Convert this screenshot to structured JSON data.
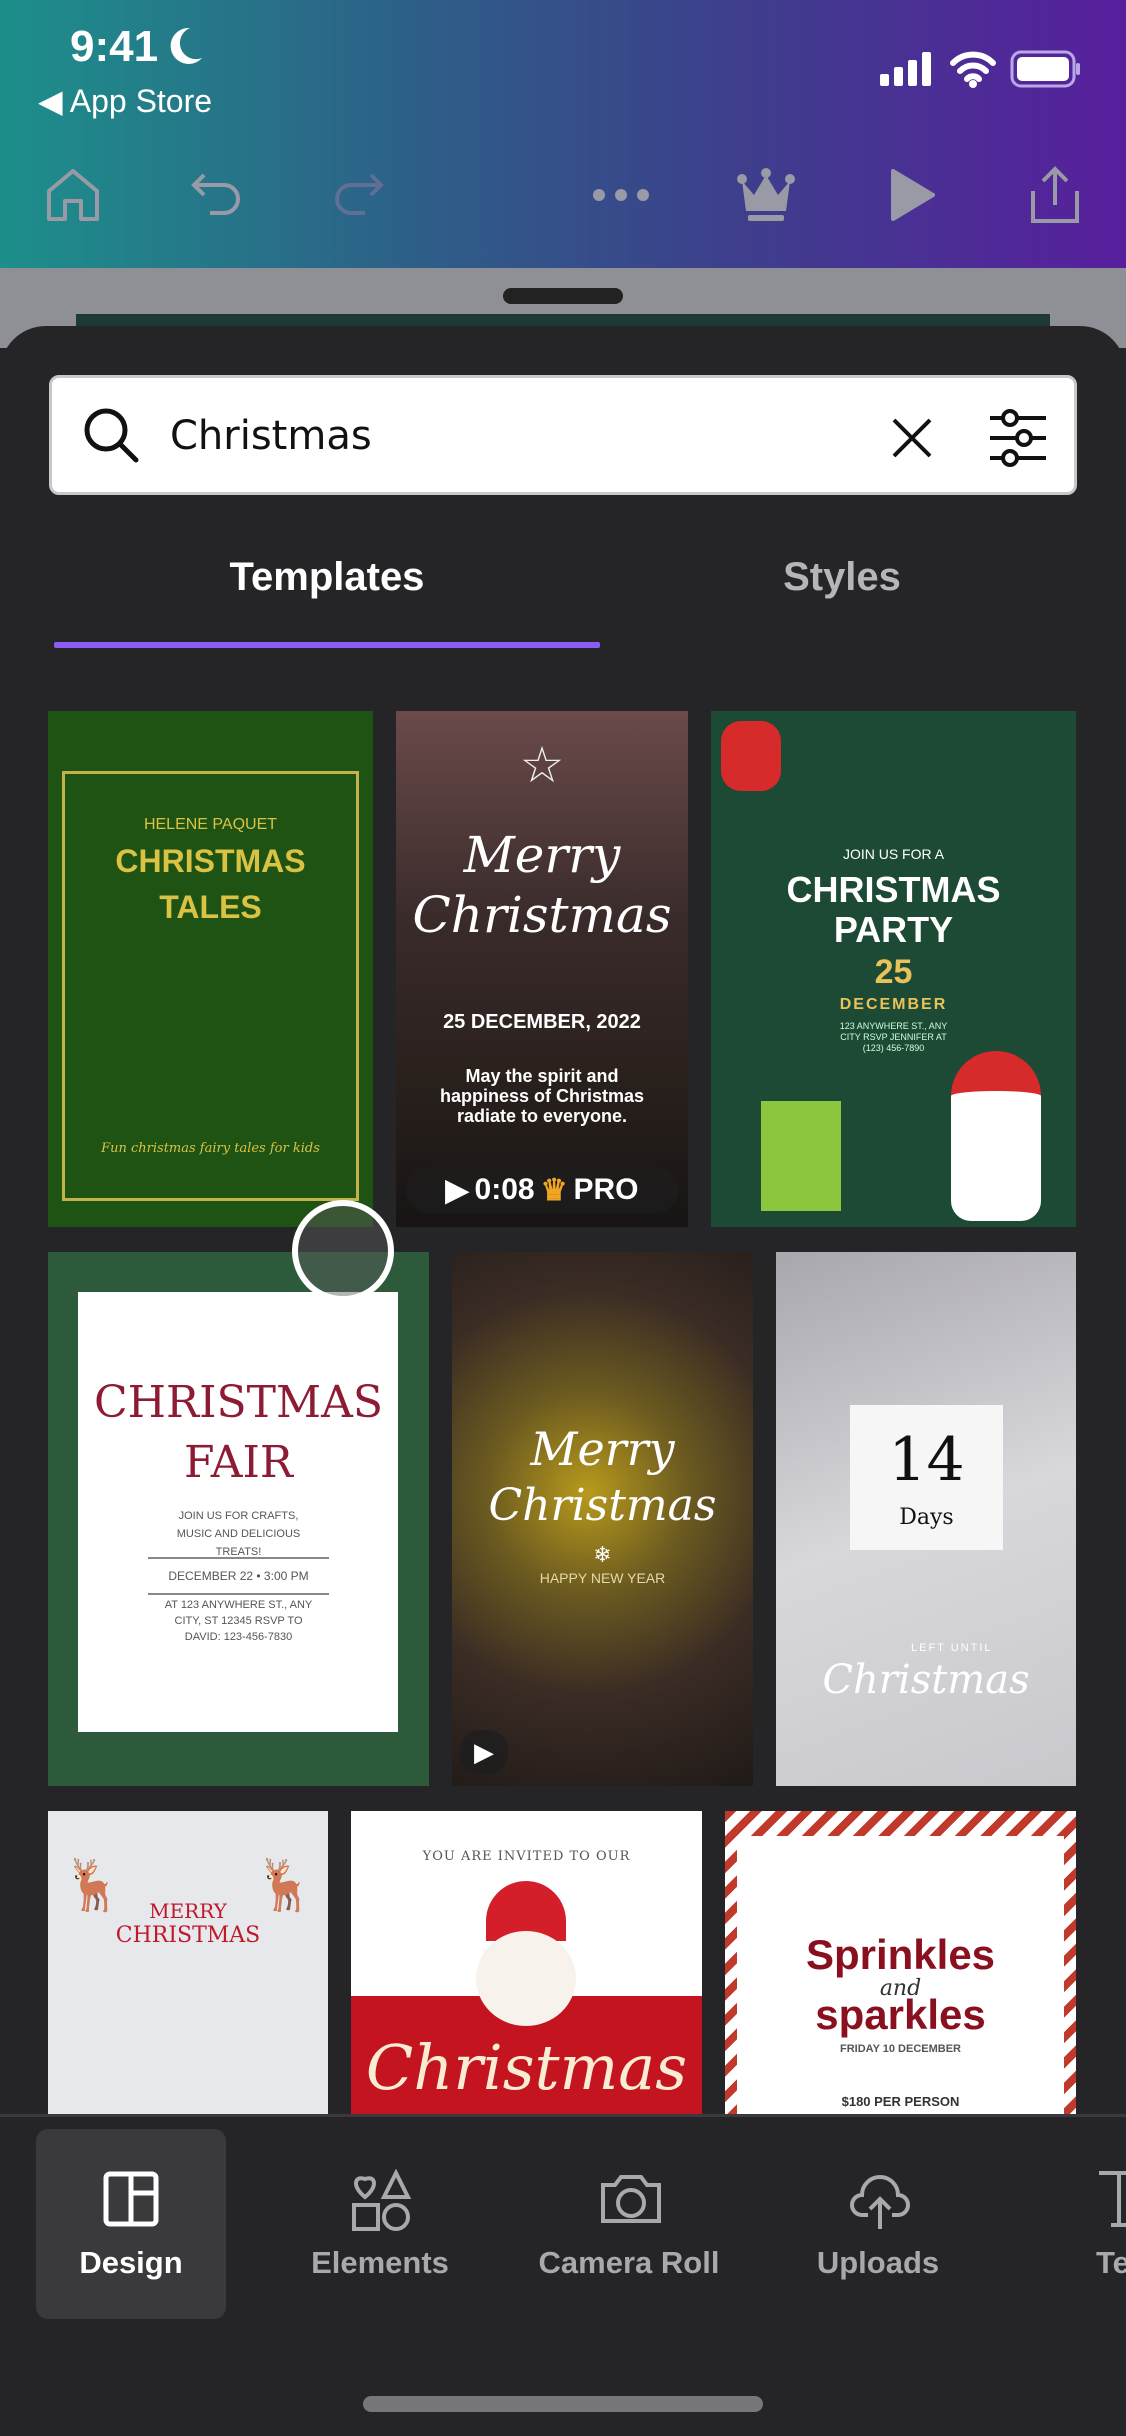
{
  "status_bar": {
    "time": "9:41",
    "back_label": "App Store",
    "icons": [
      "moon-icon",
      "signal-icon",
      "wifi-icon",
      "battery-icon"
    ]
  },
  "toolbar": {
    "icons": [
      "home-icon",
      "undo-icon",
      "redo-icon",
      "more-icon",
      "crown-icon",
      "play-icon",
      "share-icon"
    ]
  },
  "search": {
    "value": "Christmas"
  },
  "tabs": [
    {
      "label": "Templates",
      "active": true
    },
    {
      "label": "Styles",
      "active": false
    }
  ],
  "accent": "#8b5cf6",
  "templates": [
    {
      "author": "HELENE PAQUET",
      "title1": "CHRISTMAS",
      "title2": "TALES",
      "footer": "Fun christmas fairy tales for kids"
    },
    {
      "script1": "Merry",
      "script2": "Christmas",
      "date": "25 DECEMBER, 2022",
      "body": "May the spirit and happiness of Christmas radiate to everyone.",
      "duration": "0:08",
      "badge": "PRO"
    },
    {
      "pre": "JOIN US FOR A",
      "title1": "CHRISTMAS",
      "title2": "PARTY",
      "day": "25",
      "month": "DECEMBER",
      "details": "123 ANYWHERE ST., ANY CITY RSVP JENNIFER AT (123) 456-7890"
    },
    {
      "title1": "CHRISTMAS",
      "title2": "FAIR",
      "body": "JOIN US FOR CRAFTS, MUSIC AND DELICIOUS TREATS!",
      "when": "DECEMBER 22 • 3:00 PM",
      "details": "AT 123 ANYWHERE ST., ANY CITY, ST 12345 RSVP TO DAVID: 123-456-7830"
    },
    {
      "script1": "Merry",
      "script2": "Christmas",
      "sub": "HAPPY NEW YEAR"
    },
    {
      "number": "14",
      "unit": "Days",
      "pre": "LEFT UNTIL",
      "script": "Christmas"
    },
    {
      "line1": "MERRY",
      "line2": "CHRISTMAS"
    },
    {
      "pre": "YOU ARE INVITED TO OUR",
      "script": "Christmas"
    },
    {
      "title1": "Sprinkles",
      "mid": "and",
      "title2": "sparkles",
      "date": "FRIDAY 10 DECEMBER",
      "price": "$180 PER PERSON"
    }
  ],
  "bottom_nav": [
    {
      "label": "Design",
      "active": true
    },
    {
      "label": "Elements"
    },
    {
      "label": "Camera Roll"
    },
    {
      "label": "Uploads"
    },
    {
      "label": "Te"
    }
  ]
}
